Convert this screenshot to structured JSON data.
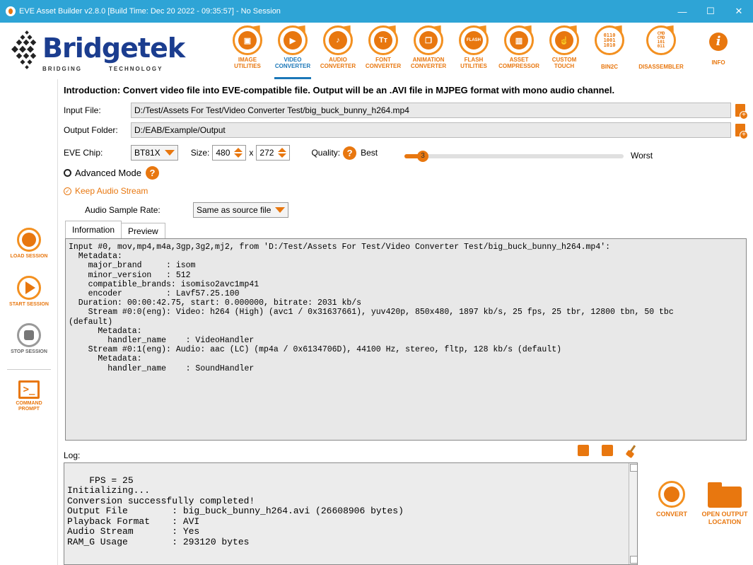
{
  "window": {
    "title": "EVE Asset Builder v2.8.0 [Build Time: Dec 20 2022 - 09:35:57] - No Session",
    "minimize": "—",
    "maximize": "☐",
    "close": "✕"
  },
  "logo": {
    "brand": "Bridgetek",
    "tagline_left": "BRIDGING",
    "tagline_right": "TECHNOLOGY"
  },
  "toolbar": [
    {
      "label": "IMAGE\nUTILITIES",
      "icon": "image-icon"
    },
    {
      "label": "VIDEO\nCONVERTER",
      "icon": "video-icon"
    },
    {
      "label": "AUDIO\nCONVERTER",
      "icon": "audio-icon"
    },
    {
      "label": "FONT\nCONVERTER",
      "icon": "font-icon"
    },
    {
      "label": "ANIMATION\nCONVERTER",
      "icon": "animation-icon"
    },
    {
      "label": "FLASH\nUTILITIES",
      "icon": "flash-icon"
    },
    {
      "label": "ASSET\nCOMPRESSOR",
      "icon": "zip-icon"
    },
    {
      "label": "CUSTOM\nTOUCH",
      "icon": "touch-icon"
    },
    {
      "label": "BIN2C",
      "icon": "binary-icon"
    },
    {
      "label": "DISASSEMBLER",
      "icon": "disassembler-icon"
    }
  ],
  "icon_text": {
    "font": "Tт",
    "flash": "FLASH",
    "bin2c": "0110\n1001\n1010",
    "disassembler": "CMD\nCMD\n101\n011"
  },
  "info": {
    "label": "INFO",
    "glyph": "i"
  },
  "sidebar": {
    "load": "LOAD SESSION",
    "start": "START SESSION",
    "stop": "STOP SESSION",
    "command": "COMMAND\nPROMPT",
    "command_glyph": ">_"
  },
  "intro": "Introduction: Convert video file into EVE-compatible file. Output will be an .AVI file in MJPEG format with mono audio channel.",
  "input_file": {
    "label": "Input File:",
    "value": "D:/Test/Assets For Test/Video Converter Test/big_buck_bunny_h264.mp4"
  },
  "output_folder": {
    "label": "Output Folder:",
    "value": "D:/EAB/Example/Output"
  },
  "eve_chip": {
    "label": "EVE Chip:",
    "value": "BT81X"
  },
  "size": {
    "label": "Size:",
    "width": "480",
    "sep": "x",
    "height": "272"
  },
  "quality": {
    "label": "Quality:",
    "help": "?",
    "best": "Best",
    "worst": "Worst",
    "value": "3",
    "level": 0.08
  },
  "advanced_mode": {
    "label": "Advanced Mode",
    "help": "?"
  },
  "keep_audio": {
    "label": "Keep Audio Stream",
    "check": "✓"
  },
  "audio_sample_rate": {
    "label": "Audio Sample Rate:",
    "value": "Same as source file"
  },
  "tabs": [
    {
      "label": "Information"
    },
    {
      "label": "Preview"
    }
  ],
  "information_text": "Input #0, mov,mp4,m4a,3gp,3g2,mj2, from 'D:/Test/Assets For Test/Video Converter Test/big_buck_bunny_h264.mp4':\n  Metadata:\n    major_brand     : isom\n    minor_version   : 512\n    compatible_brands: isomiso2avc1mp41\n    encoder         : Lavf57.25.100\n  Duration: 00:00:42.75, start: 0.000000, bitrate: 2031 kb/s\n    Stream #0:0(eng): Video: h264 (High) (avc1 / 0x31637661), yuv420p, 850x480, 1897 kb/s, 25 fps, 25 tbr, 12800 tbn, 50 tbc\n(default)\n      Metadata:\n        handler_name    : VideoHandler\n    Stream #0:1(eng): Audio: aac (LC) (mp4a / 0x6134706D), 44100 Hz, stereo, fltp, 128 kb/s (default)\n      Metadata:\n        handler_name    : SoundHandler",
  "log": {
    "label": "Log:",
    "text": "FPS = 25\nInitializing...\nConversion successfully completed!\nOutput File        : big_buck_bunny_h264.avi (26608906 bytes)\nPlayback Format    : AVI\nAudio Stream       : Yes\nRAM_G Usage        : 293120 bytes"
  },
  "actions": {
    "convert": "CONVERT",
    "open_output": "OPEN OUTPUT\nLOCATION"
  },
  "colors": {
    "accent": "#e8770f",
    "titlebar": "#2ea4d6",
    "brand": "#1b3d8f",
    "active": "#1b77b8"
  }
}
